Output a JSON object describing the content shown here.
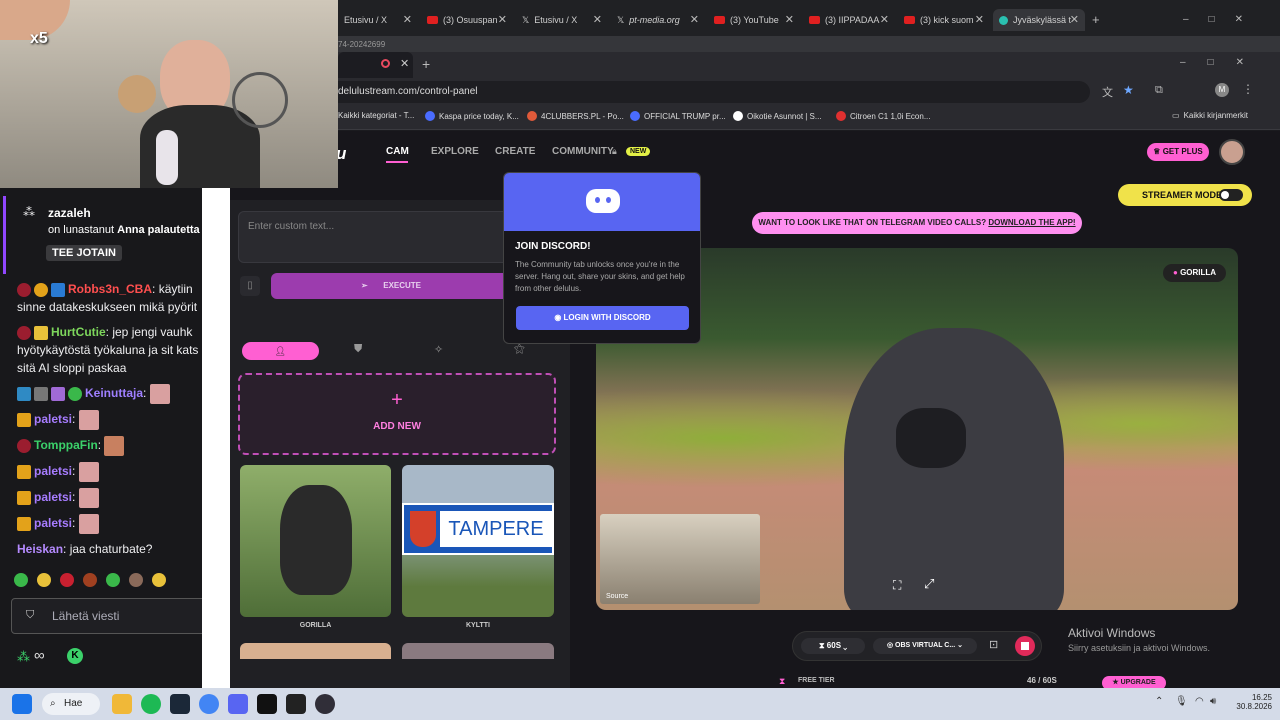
{
  "stream": {
    "multiplier": "x5"
  },
  "bg_browser": {
    "tabs": [
      "Etusivu / X",
      "(3) Osuuspan",
      "Etusivu / X",
      "pt-media.org",
      "(3) YouTube",
      "(3) IIPPADAA",
      "(3) kick suom",
      "Jyväskylässä t"
    ],
    "address_fragment": "74-20242699"
  },
  "browser": {
    "url": "delulustream.com/control-panel",
    "bookmarks": [
      "Kaikki kategoriat - T...",
      "Kaspa price today, K...",
      "4CLUBBERS.PL - Po...",
      "OFFICIAL TRUMP pr...",
      "Oikotie Asunnot | S...",
      "Citroen C1 1,0i Econ..."
    ],
    "all_bookmarks": "Kaikki kirjanmerkit"
  },
  "site": {
    "logo": "u",
    "nav": {
      "cam": "CAM",
      "explore": "EXPLORE",
      "create": "CREATE",
      "community": "COMMUNITY",
      "new_badge": "NEW"
    },
    "get_plus": "GET PLUS",
    "streamer_mode": "STREAMER MODE",
    "promo": "WANT TO LOOK LIKE THAT ON TELEGRAM VIDEO CALLS?",
    "promo_link": "DOWNLOAD THE APP!",
    "custom_text_placeholder": "Enter custom text...",
    "execute": "EXECUTE",
    "add_new": "ADD NEW",
    "skins": [
      {
        "name": "GORILLA"
      },
      {
        "name": "KYLTTI",
        "sign": "TAMPERE"
      }
    ],
    "video_tag": "GORILLA",
    "source_label": "Source",
    "timer": "60S",
    "camera": "OBS VIRTUAL C...",
    "free_tier": "FREE TIER",
    "usage": "46 / 60S",
    "upgrade": "UPGRADE",
    "discord": {
      "title": "JOIN DISCORD!",
      "body": "The Community tab unlocks once you're in the server. Hang out, share your skins, and get help from other delulus.",
      "button": "LOGIN WITH DISCORD"
    },
    "activate": {
      "title": "Aktivoi Windows",
      "sub": "Siirry asetuksiin ja aktivoi Windows."
    }
  },
  "chat": {
    "top_user": "zazaleh",
    "top_text": "on lunastanut",
    "top_bold": "Anna palautetta",
    "redeem": "TEE JOTAIN",
    "messages": [
      {
        "user": "Robbs3n_CBA",
        "color": "#ff4f4f",
        "text": "käytiin",
        "cont": "sinne datakeskukseen mikä pyörit"
      },
      {
        "user": "HurtCutie",
        "color": "#7dd65c",
        "text": "jep jengi vauhk",
        "cont": "hyötykäytöstä työkaluna ja sit kats",
        "cont2": "sitä AI sloppi paskaa"
      },
      {
        "user": "Keinuttaja",
        "color": "#9f7fff",
        "text": ""
      },
      {
        "user": "paletsi",
        "color": "#a77cff",
        "text": ""
      },
      {
        "user": "TomppaFin",
        "color": "#3bd16a",
        "text": ""
      },
      {
        "user": "paletsi",
        "color": "#a77cff",
        "text": ""
      },
      {
        "user": "paletsi",
        "color": "#a77cff",
        "text": ""
      },
      {
        "user": "paletsi",
        "color": "#a77cff",
        "text": ""
      },
      {
        "user": "Heiskan",
        "color": "#b58aff",
        "text": "jaa chaturbate?"
      }
    ],
    "input_placeholder": "Lähetä viesti"
  },
  "taskbar": {
    "search": "Hae",
    "time": "16.25",
    "date": "30.8.2026"
  }
}
